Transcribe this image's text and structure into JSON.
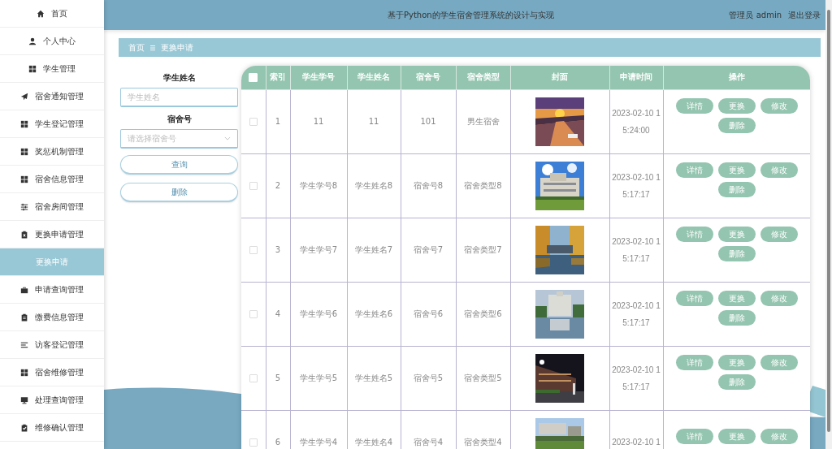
{
  "header": {
    "title": "基于Python的学生宿舍管理系统的设计与实现",
    "user": "管理员 admin",
    "logout": "退出登录"
  },
  "sidebar": {
    "items": [
      {
        "label": "首页",
        "selected": false
      },
      {
        "label": "个人中心",
        "selected": false
      },
      {
        "label": "学生管理",
        "selected": false
      },
      {
        "label": "宿舍通知管理",
        "selected": false
      },
      {
        "label": "学生登记管理",
        "selected": false
      },
      {
        "label": "奖惩机制管理",
        "selected": false
      },
      {
        "label": "宿舍信息管理",
        "selected": false
      },
      {
        "label": "宿舍房间管理",
        "selected": false
      },
      {
        "label": "更换申请管理",
        "selected": false,
        "expanded": true,
        "children": [
          {
            "label": "更换申请",
            "selected": true
          }
        ]
      },
      {
        "label": "申请查询管理",
        "selected": false
      },
      {
        "label": "缴费信息管理",
        "selected": false
      },
      {
        "label": "访客登记管理",
        "selected": false
      },
      {
        "label": "宿舍维修管理",
        "selected": false
      },
      {
        "label": "处理查询管理",
        "selected": false
      },
      {
        "label": "维修确认管理",
        "selected": false
      }
    ]
  },
  "breadcrumb": [
    "首页",
    "更换申请"
  ],
  "search": {
    "fields": [
      {
        "kind": "text",
        "label": "学生姓名",
        "placeholder": "学生姓名"
      },
      {
        "kind": "select",
        "label": "宿舍号",
        "placeholder": "请选择宿舍号"
      }
    ],
    "buttons": [
      "查询",
      "删除"
    ]
  },
  "table": {
    "select_all": {
      "checked": false
    },
    "columns": [
      "索引",
      "学生学号",
      "学生姓名",
      "宿舍号",
      "宿舍类型",
      "封面",
      "申请时间",
      "操作"
    ],
    "rows": [
      {
        "checked": false,
        "cells": [
          "1",
          "11",
          "11",
          "101",
          "男生宿舍"
        ],
        "time": "2023-02-10 15:24:00",
        "actions": [
          "详情",
          "更换",
          "修改",
          "删除"
        ]
      },
      {
        "checked": false,
        "cells": [
          "2",
          "学生学号8",
          "学生姓名8",
          "宿舍号8",
          "宿舍类型8"
        ],
        "time": "2023-02-10 15:17:17",
        "actions": [
          "详情",
          "更换",
          "修改",
          "删除"
        ]
      },
      {
        "checked": false,
        "cells": [
          "3",
          "学生学号7",
          "学生姓名7",
          "宿舍号7",
          "宿舍类型7"
        ],
        "time": "2023-02-10 15:17:17",
        "actions": [
          "详情",
          "更换",
          "修改",
          "删除"
        ]
      },
      {
        "checked": false,
        "cells": [
          "4",
          "学生学号6",
          "学生姓名6",
          "宿舍号6",
          "宿舍类型6"
        ],
        "time": "2023-02-10 15:17:17",
        "actions": [
          "详情",
          "更换",
          "修改",
          "删除"
        ]
      },
      {
        "checked": false,
        "cells": [
          "5",
          "学生学号5",
          "学生姓名5",
          "宿舍号5",
          "宿舍类型5"
        ],
        "time": "2023-02-10 15:17:17",
        "actions": [
          "详情",
          "更换",
          "修改",
          "删除"
        ]
      },
      {
        "checked": false,
        "cells": [
          "6",
          "学生学号4",
          "学生姓名4",
          "宿舍号4",
          "宿舍类型4"
        ],
        "time": "2023-02-10 1",
        "actions": [
          "详情",
          "更换",
          "修改"
        ]
      }
    ]
  }
}
